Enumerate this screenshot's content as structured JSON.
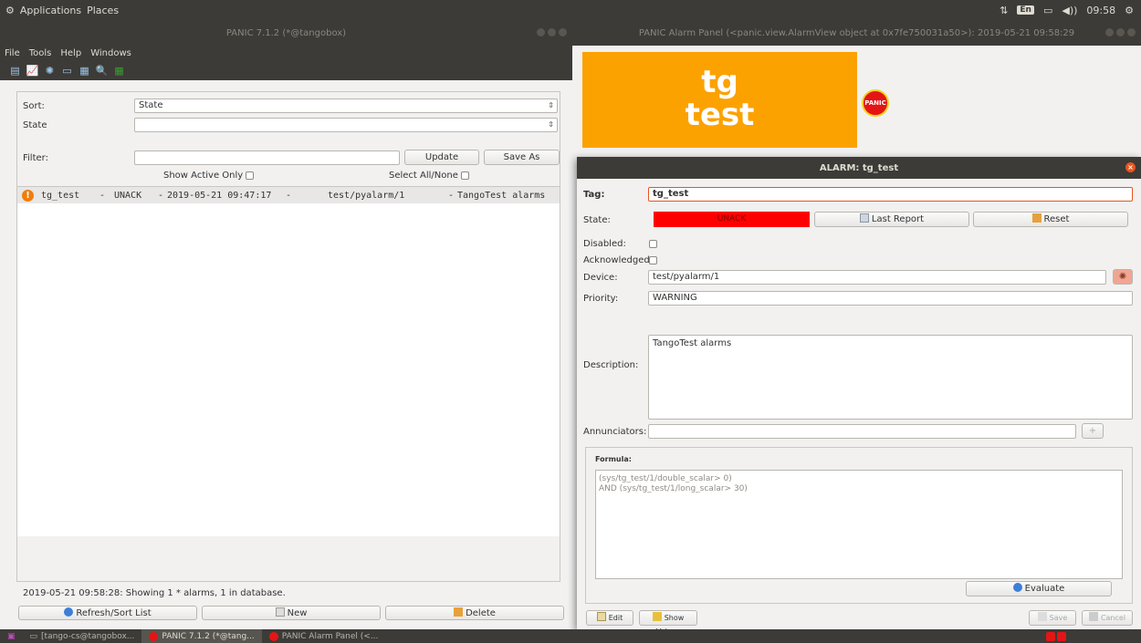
{
  "top_panel": {
    "applications": "Applications",
    "places": "Places",
    "lang_badge": "En",
    "volume_glyph": "◀))",
    "time": "09:58"
  },
  "left_window": {
    "title": "PANIC 7.1.2 (*@tangobox)",
    "menu": [
      "File",
      "Tools",
      "Help",
      "Windows"
    ],
    "toolbar_icons": [
      "list-icon",
      "chart-icon",
      "gear-icon",
      "terminal-icon",
      "calculator-icon",
      "search-icon",
      "grid-icon"
    ],
    "sort_label": "Sort:",
    "sort_value": "State",
    "state_label": "State",
    "state_value": "",
    "filter_label": "Filter:",
    "filter_value": "",
    "update_label": "Update",
    "save_as_label": "Save As",
    "show_active_label": "Show Active Only",
    "select_all_label": "Select All/None",
    "alarms": [
      {
        "tag": "tg_test",
        "state": "UNACK",
        "date": "2019-05-21 09:47:17",
        "device": "test/pyalarm/1",
        "description": "TangoTest alarms"
      }
    ],
    "status": "2019-05-21 09:58:28: Showing 1 * alarms, 1 in database.",
    "refresh_label": "Refresh/Sort List",
    "new_label": "New",
    "delete_label": "Delete"
  },
  "right_window": {
    "title": "PANIC Alarm Panel (<panic.view.AlarmView object at 0x7fe750031a50>): 2019-05-21 09:58:29",
    "tile_line1": "tg",
    "tile_line2": "test",
    "logo_text": "PANIC",
    "tile_color": "#fba200"
  },
  "dialog": {
    "title": "ALARM: tg_test",
    "tag_label": "Tag:",
    "tag_value": "tg_test",
    "state_label": "State:",
    "state_value": "UNACK",
    "state_color": "#ff0000",
    "last_report_label": "Last Report",
    "reset_label": "Reset",
    "disabled_label": "Disabled:",
    "acknowledged_label": "Acknowledged:",
    "device_label": "Device:",
    "device_value": "test/pyalarm/1",
    "priority_label": "Priority:",
    "priority_value": "WARNING",
    "description_label": "Description:",
    "description_value": "TangoTest alarms",
    "annunciators_label": "Annunciators:",
    "annunciators_value": "",
    "add_annunciator_glyph": "+",
    "formula_label": "Formula:",
    "formula_line1": "(sys/tg_test/1/double_scalar> 0)",
    "formula_line2": "AND (sys/tg_test/1/long_scalar> 30)",
    "evaluate_label": "Evaluate",
    "edit_label": "Edit",
    "show_values_label": "Show Values",
    "save_label": "Save",
    "cancel_label": "Cancel"
  },
  "taskbar": {
    "items": [
      "[tango-cs@tangobox...",
      "PANIC 7.1.2 (*@tang...",
      "PANIC Alarm Panel (<..."
    ]
  }
}
